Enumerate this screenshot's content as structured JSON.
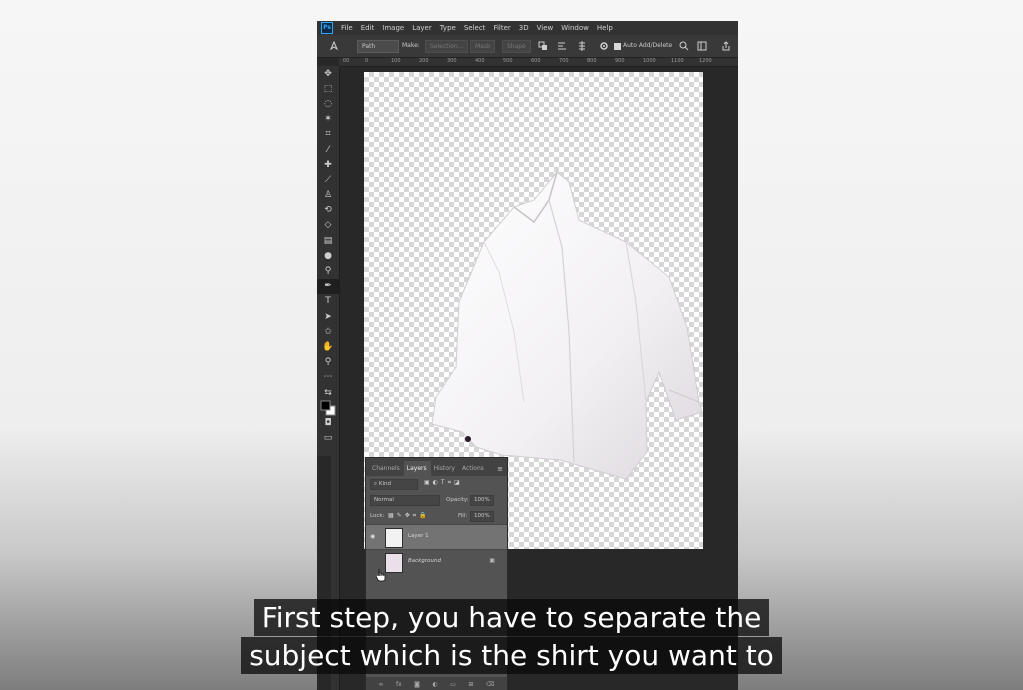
{
  "menubar": {
    "logo": "Ps",
    "items": [
      "File",
      "Edit",
      "Image",
      "Layer",
      "Type",
      "Select",
      "Filter",
      "3D",
      "View",
      "Window",
      "Help"
    ]
  },
  "options_bar": {
    "tool_mode": "Path",
    "make_label": "Make:",
    "selection_button": "Selection...",
    "mask_button": "Mask",
    "shape_button": "Shape",
    "auto_add_delete": "Auto Add/Delete"
  },
  "ruler_labels": [
    "00",
    "0",
    "100",
    "200",
    "300",
    "400",
    "500",
    "600",
    "700",
    "800",
    "900",
    "1000",
    "1100",
    "1200"
  ],
  "layers_panel": {
    "tabs": [
      "Channels",
      "Layers",
      "History",
      "Actions"
    ],
    "active_tab": "Layers",
    "filter_kind": "Kind",
    "blend_mode": "Normal",
    "opacity_label": "Opacity:",
    "opacity_value": "100%",
    "lock_label": "Lock:",
    "fill_label": "Fill:",
    "fill_value": "100%",
    "layers": [
      {
        "name": "Layer 1",
        "selected": true
      },
      {
        "name": "Background",
        "locked": true
      }
    ]
  },
  "subtitles": [
    "First step, you have to separate the",
    "subject which is the shirt you want to"
  ],
  "colors": {
    "ps_blue": "#31a8ff",
    "panel_bg": "#535353",
    "workspace_bg": "#282828",
    "subtitle_bg": "#141414"
  }
}
